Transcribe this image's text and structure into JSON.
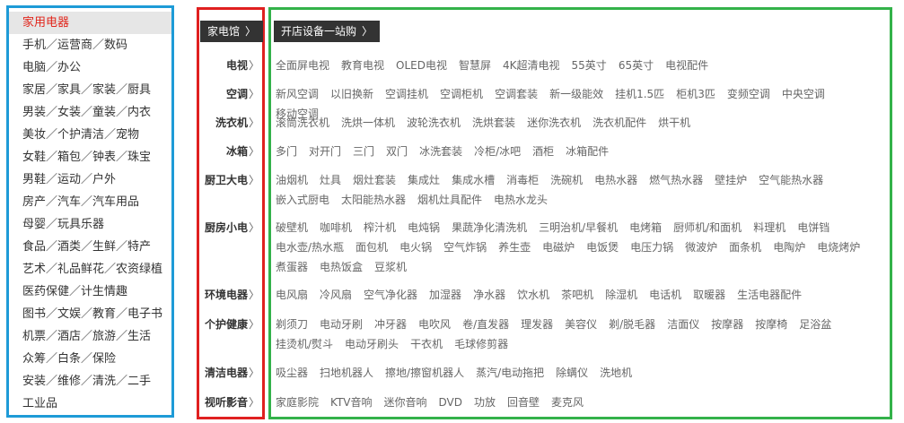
{
  "left_menu": {
    "items": [
      "家用电器",
      "手机／运营商／数码",
      "电脑／办公",
      "家居／家具／家装／厨具",
      "男装／女装／童装／内衣",
      "美妆／个护清洁／宠物",
      "女鞋／箱包／钟表／珠宝",
      "男鞋／运动／户外",
      "房产／汽车／汽车用品",
      "母婴／玩具乐器",
      "食品／酒类／生鲜／特产",
      "艺术／礼品鲜花／农资绿植",
      "医药保健／计生情趣",
      "图书／文娱／教育／电子书",
      "机票／酒店／旅游／生活",
      "众筹／白条／保险",
      "安装／维修／清洗／二手",
      "工业品"
    ]
  },
  "top_tags": {
    "appliance_hall": "家电馆",
    "store_equipment": "开店设备一站购",
    "chevron": "〉"
  },
  "categories": [
    {
      "label": "电视",
      "items": [
        "全面屏电视",
        "教育电视",
        "OLED电视",
        "智慧屏",
        "4K超清电视",
        "55英寸",
        "65英寸",
        "电视配件"
      ]
    },
    {
      "label": "空调",
      "items": [
        "新风空调",
        "以旧换新",
        "空调挂机",
        "空调柜机",
        "空调套装",
        "新一级能效",
        "挂机1.5匹",
        "柜机3匹",
        "变频空调",
        "中央空调",
        "移动空调"
      ]
    },
    {
      "label": "洗衣机",
      "items": [
        "滚筒洗衣机",
        "洗烘一体机",
        "波轮洗衣机",
        "洗烘套装",
        "迷你洗衣机",
        "洗衣机配件",
        "烘干机"
      ]
    },
    {
      "label": "冰箱",
      "items": [
        "多门",
        "对开门",
        "三门",
        "双门",
        "冰洗套装",
        "冷柜/冰吧",
        "酒柜",
        "冰箱配件"
      ]
    },
    {
      "label": "厨卫大电",
      "items": [
        "油烟机",
        "灶具",
        "烟灶套装",
        "集成灶",
        "集成水槽",
        "消毒柜",
        "洗碗机",
        "电热水器",
        "燃气热水器",
        "壁挂炉",
        "空气能热水器",
        "嵌入式厨电",
        "太阳能热水器",
        "烟机灶具配件",
        "电热水龙头"
      ]
    },
    {
      "label": "厨房小电",
      "items": [
        "破壁机",
        "咖啡机",
        "榨汁机",
        "电炖锅",
        "果蔬净化清洗机",
        "三明治机/早餐机",
        "电烤箱",
        "厨师机/和面机",
        "料理机",
        "电饼铛",
        "电水壶/热水瓶",
        "面包机",
        "电火锅",
        "空气炸锅",
        "养生壶",
        "电磁炉",
        "电饭煲",
        "电压力锅",
        "微波炉",
        "面条机",
        "电陶炉",
        "电烧烤炉",
        "煮蛋器",
        "电热饭盒",
        "豆浆机"
      ]
    },
    {
      "label": "环境电器",
      "items": [
        "电风扇",
        "冷风扇",
        "空气净化器",
        "加湿器",
        "净水器",
        "饮水机",
        "茶吧机",
        "除湿机",
        "电话机",
        "取暖器",
        "生活电器配件"
      ]
    },
    {
      "label": "个护健康",
      "items": [
        "剃须刀",
        "电动牙刷",
        "冲牙器",
        "电吹风",
        "卷/直发器",
        "理发器",
        "美容仪",
        "剃/脱毛器",
        "洁面仪",
        "按摩器",
        "按摩椅",
        "足浴盆",
        "挂烫机/熨斗",
        "电动牙刷头",
        "干衣机",
        "毛球修剪器"
      ]
    },
    {
      "label": "清洁电器",
      "items": [
        "吸尘器",
        "扫地机器人",
        "擦地/擦窗机器人",
        "蒸汽/电动拖把",
        "除螨仪",
        "洗地机"
      ]
    },
    {
      "label": "视听影音",
      "items": [
        "家庭影院",
        "KTV音响",
        "迷你音响",
        "DVD",
        "功放",
        "回音壁",
        "麦克风"
      ]
    }
  ]
}
